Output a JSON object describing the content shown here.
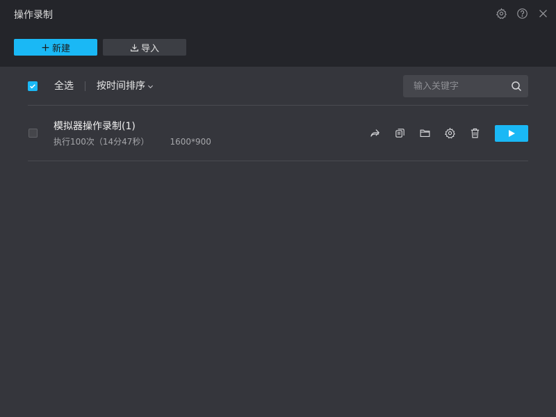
{
  "window": {
    "title": "操作录制"
  },
  "header": {
    "controls": [
      {
        "icon": "gear-icon"
      },
      {
        "icon": "help-icon"
      },
      {
        "icon": "close-icon"
      }
    ],
    "new_label": "新建",
    "import_label": "导入"
  },
  "toolbar": {
    "select_all_label": "全选",
    "select_all_checked": true,
    "sort_label": "按时间排序",
    "search_placeholder": "输入关键字"
  },
  "recordings": [
    {
      "name": "模拟器操作录制(1)",
      "run_info": "执行100次（14分47秒）",
      "resolution": "1600*900",
      "checked": false,
      "actions": [
        "share-icon",
        "copy-icon",
        "folder-icon",
        "settings-icon",
        "trash-icon"
      ]
    }
  ],
  "colors": {
    "accent": "#1ab8f5",
    "header_bg": "#24252a",
    "body_bg": "#35363c"
  }
}
